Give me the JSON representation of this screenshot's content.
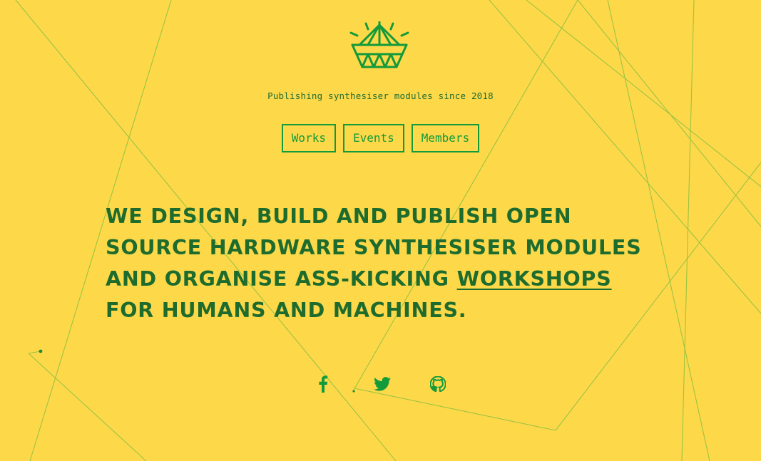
{
  "brand": {
    "logo_icon": "diamond-logo-icon",
    "tagline": "Publishing synthesiser modules since 2018"
  },
  "nav": {
    "items": [
      {
        "label": "Works"
      },
      {
        "label": "Events"
      },
      {
        "label": "Members"
      }
    ]
  },
  "headline": {
    "line_text": "We design, build and publish open source hardware synthesiser modules and organise ass-kicking ",
    "link_text": "workshops",
    "trailing_text": " for humans and machines."
  },
  "social": {
    "items": [
      {
        "name": "facebook",
        "icon": "facebook-icon"
      },
      {
        "name": "twitter",
        "icon": "twitter-icon"
      },
      {
        "name": "github",
        "icon": "github-icon"
      }
    ]
  },
  "colors": {
    "background": "#fdd94a",
    "accent": "#139a3a",
    "text": "#1e6b2e",
    "lines": "#7fb83e"
  }
}
